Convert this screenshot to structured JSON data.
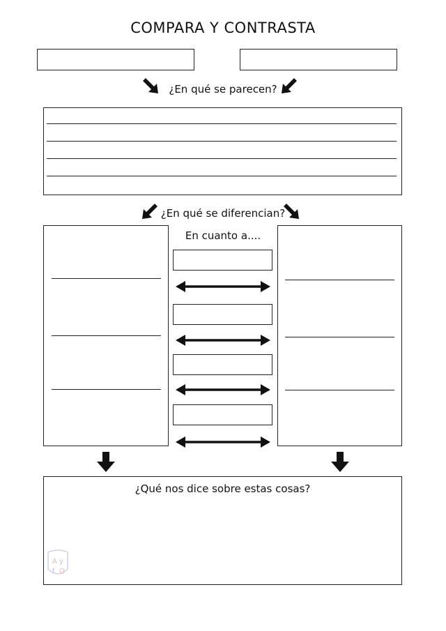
{
  "title": "COMPARA Y CONTRASTA",
  "q_similar": "¿En qué se parecen?",
  "q_different": "¿En qué se diferencian?",
  "en_cuanto": "En cuanto a....",
  "q_says": "¿Qué nos dice sobre estas cosas?",
  "logo": {
    "letters": [
      "A",
      "y",
      "f",
      "Q"
    ]
  }
}
